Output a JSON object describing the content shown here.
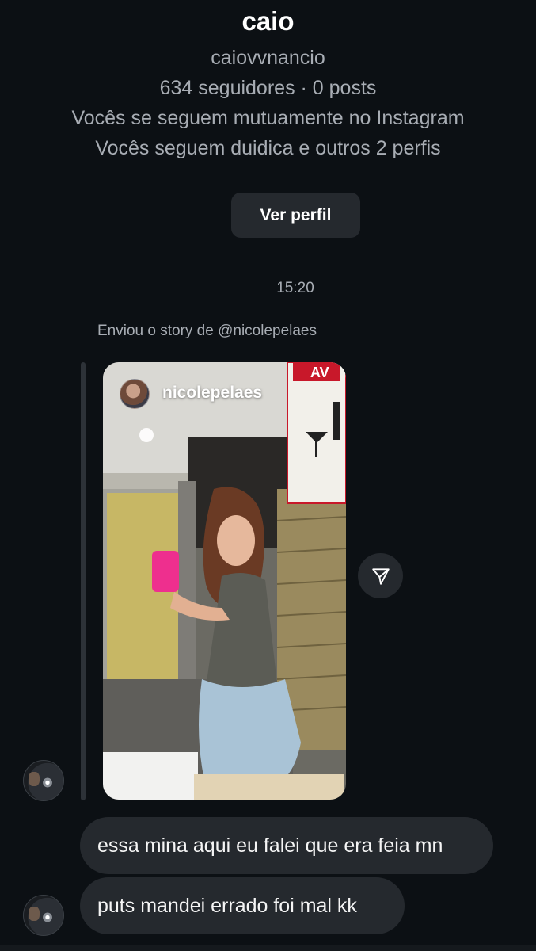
{
  "profile": {
    "name": "caio",
    "username": "caiovvnancio",
    "stats": "634 seguidores · 0 posts",
    "mutual": "Vocês se seguem mutuamente no Instagram",
    "following": "Vocês seguem duidica e outros 2 perfis",
    "view_profile_label": "Ver perfil"
  },
  "chat": {
    "timestamp": "15:20",
    "story_note": "Enviou o story de @nicolepelaes",
    "story": {
      "username": "nicolepelaes",
      "sign_text": "AV"
    },
    "messages": [
      {
        "text": "essa mina aqui eu falei que era feia mn"
      },
      {
        "text": "puts mandei errado foi mal kk"
      }
    ]
  },
  "icons": {
    "share": "paper-plane-icon",
    "story_avatar": "story-author-avatar",
    "sender_avatar": "sender-avatar"
  },
  "colors": {
    "background": "#0c1014",
    "bubble": "#25292e",
    "secondary_text": "#a8adb4"
  }
}
